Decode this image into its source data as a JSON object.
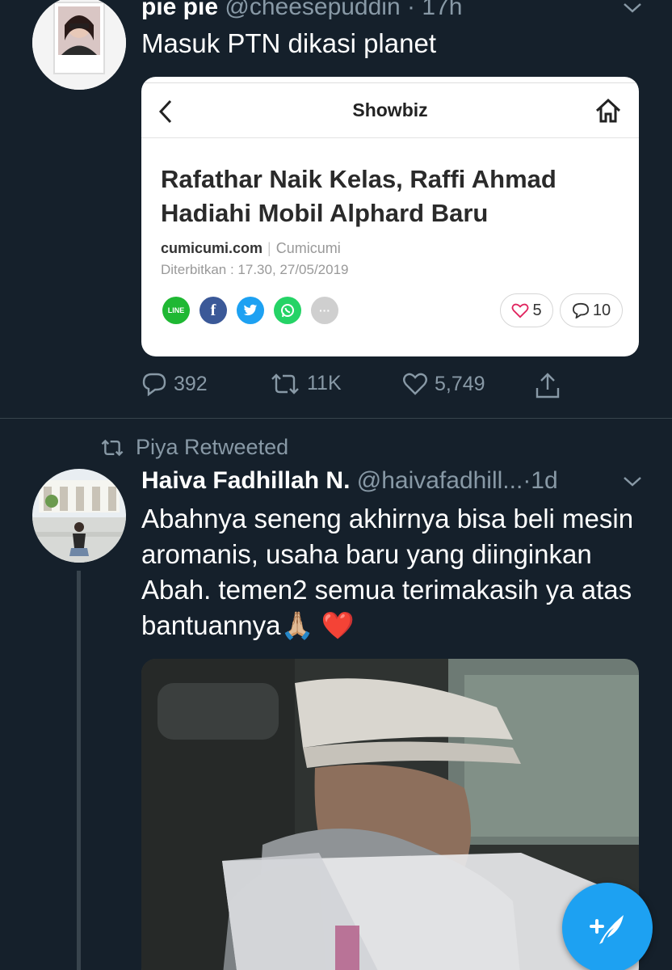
{
  "tweet1": {
    "name": "pie pie",
    "handle": "@cheesepuddin",
    "time": "· 17h",
    "text": "Masuk PTN dikasi planet",
    "card": {
      "nav_title": "Showbiz",
      "headline": "Rafathar Naik Kelas, Raffi Ahmad Hadiahi Mobil Alphard Baru",
      "site": "cumicumi.com",
      "brand": "Cumicumi",
      "published": "Diterbitkan : 17.30, 27/05/2019",
      "share_icons": [
        "line-icon",
        "facebook-icon",
        "twitter-icon",
        "whatsapp-icon",
        "more-icon"
      ],
      "line_label": "LINE",
      "facebook_label": "f",
      "more_label": "···",
      "likes": "5",
      "comments": "10",
      "like_color": "#e0245e"
    },
    "actions": {
      "replies": "392",
      "retweets": "11K",
      "likes": "5,749"
    }
  },
  "tweet2": {
    "social_context": "Piya Retweeted",
    "name": "Haiva Fadhillah N.",
    "handle": "@haivafadhill...",
    "time": "·1d",
    "text": "Abahnya seneng akhirnya bisa beli mesin aromanis, usaha baru yang diinginkan Abah. temen2 semua terimakasih ya atas bantuannya🙏🏼 ❤️"
  },
  "colors": {
    "background": "#15202b",
    "secondary_text": "#8899a6",
    "accent": "#1da1f2"
  },
  "fab": {
    "icon": "compose-tweet-icon"
  }
}
